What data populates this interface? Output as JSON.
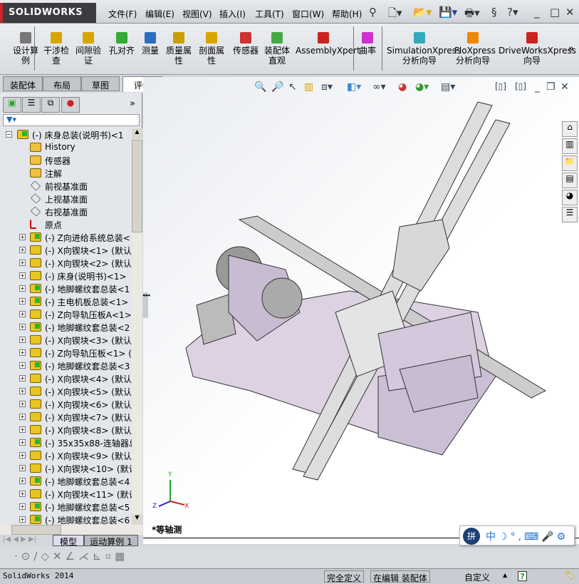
{
  "app": {
    "logo": "SOLIDWORKS",
    "status_app": "SolidWorks 2014"
  },
  "menu": [
    "文件(F)",
    "编辑(E)",
    "视图(V)",
    "插入(I)",
    "工具(T)",
    "窗口(W)",
    "帮助(H)"
  ],
  "quick_access": [
    "new-icon",
    "open-icon",
    "save-icon",
    "print-icon",
    "rebuild-icon",
    "help-icon"
  ],
  "commands": [
    {
      "label": "设计算\n例",
      "icon": "design-study-icon"
    },
    {
      "label": "干涉检\n查",
      "icon": "interference-icon"
    },
    {
      "label": "间隙验\n证",
      "icon": "clearance-icon"
    },
    {
      "label": "孔对齐",
      "icon": "hole-align-icon"
    },
    {
      "label": "测量",
      "icon": "measure-icon"
    },
    {
      "label": "质量属\n性",
      "icon": "mass-properties-icon"
    },
    {
      "label": "剖面属\n性",
      "icon": "section-properties-icon"
    },
    {
      "label": "传感器",
      "icon": "sensor-icon"
    },
    {
      "label": "装配体\n直观",
      "icon": "assembly-visualization-icon"
    },
    {
      "label": "AssemblyXpert",
      "icon": "assemblyxpert-icon"
    },
    {
      "label": "曲率",
      "icon": "curvature-icon"
    },
    {
      "label": "SimulationXpress\n分析向导",
      "icon": "simulationxpress-icon"
    },
    {
      "label": "FloXpress\n分析向导",
      "icon": "floxpress-icon"
    },
    {
      "label": "DriveWorksXpress\n向导",
      "icon": "driveworksxpress-icon"
    }
  ],
  "tabs": [
    {
      "label": "装配体"
    },
    {
      "label": "布局"
    },
    {
      "label": "草图"
    },
    {
      "label": "评估",
      "active": true
    }
  ],
  "tree": {
    "root": "(-) 床身总装(说明书)<1",
    "items": [
      {
        "label": "History",
        "icon": "history"
      },
      {
        "label": "传感器",
        "icon": "sensor"
      },
      {
        "label": "注解",
        "icon": "annotation"
      },
      {
        "label": "前视基准面",
        "icon": "plane"
      },
      {
        "label": "上视基准面",
        "icon": "plane"
      },
      {
        "label": "右视基准面",
        "icon": "plane"
      },
      {
        "label": "原点",
        "icon": "origin"
      },
      {
        "label": "(-) Z向进给系统总装<",
        "icon": "asm"
      },
      {
        "label": "(-) X向锲块<1> (默认",
        "icon": "part"
      },
      {
        "label": "(-) X向锲块<2> (默认",
        "icon": "part"
      },
      {
        "label": "(-) 床身(说明书)<1>",
        "icon": "part"
      },
      {
        "label": "(-) 地脚螺纹套总装<1",
        "icon": "asm"
      },
      {
        "label": "(-) 主电机板总装<1>",
        "icon": "asm"
      },
      {
        "label": "(-) Z向导轨压板A<1>",
        "icon": "part"
      },
      {
        "label": "(-) 地脚螺纹套总装<2",
        "icon": "asm"
      },
      {
        "label": "(-) X向锲块<3> (默认",
        "icon": "part"
      },
      {
        "label": "(-) Z向导轨压板<1> (",
        "icon": "part"
      },
      {
        "label": "(-) 地脚螺纹套总装<3",
        "icon": "asm"
      },
      {
        "label": "(-) X向锲块<4> (默认",
        "icon": "part"
      },
      {
        "label": "(-) X向锲块<5> (默认",
        "icon": "part"
      },
      {
        "label": "(-) X向锲块<6> (默认",
        "icon": "part"
      },
      {
        "label": "(-) X向锲块<7> (默认",
        "icon": "part"
      },
      {
        "label": "(-) X向锲块<8> (默认",
        "icon": "part"
      },
      {
        "label": "(-) 35x35x88-连轴器总",
        "icon": "asm"
      },
      {
        "label": "(-) X向锲块<9> (默认",
        "icon": "part"
      },
      {
        "label": "(-) X向锲块<10> (默认",
        "icon": "part"
      },
      {
        "label": "(-) 地脚螺纹套总装<4",
        "icon": "asm"
      },
      {
        "label": "(-) X向锲块<11> (默认",
        "icon": "part"
      },
      {
        "label": "(-) 地脚螺纹套总装<5",
        "icon": "asm"
      },
      {
        "label": "(-) 地脚螺纹套总装<6",
        "icon": "asm"
      }
    ]
  },
  "bottom_tabs": [
    "模型",
    "运动算例 1"
  ],
  "view": {
    "orientation_label": "*等轴测",
    "axes": [
      "X",
      "Y",
      "Z"
    ]
  },
  "status": {
    "definition": "完全定义",
    "editing": "在编辑 装配体",
    "units": "自定义"
  },
  "ime": {
    "labels": [
      "中",
      "☽",
      "°,",
      "⌨",
      "🎤",
      "⚙"
    ]
  },
  "colors": {
    "accent": "#c8262a",
    "part": "#e8c520",
    "body": "#d8cde0"
  }
}
